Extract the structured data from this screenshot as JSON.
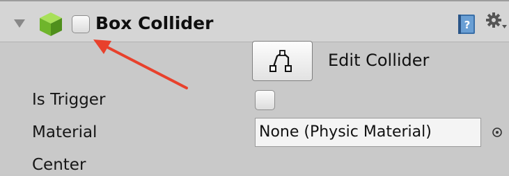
{
  "component": {
    "title": "Box Collider",
    "icon": "cube-icon",
    "enabled": false
  },
  "header_icons": {
    "help": "help-book-icon",
    "settings": "gear-icon"
  },
  "edit_collider": {
    "label": "Edit Collider",
    "icon": "edit-collider-icon"
  },
  "properties": {
    "is_trigger": {
      "label": "Is Trigger",
      "checked": false
    },
    "material": {
      "label": "Material",
      "value": "None (Physic Material)"
    },
    "center": {
      "label": "Center"
    }
  },
  "colors": {
    "annotation_arrow": "#e8412c",
    "cube_green": "#7cc63a"
  }
}
